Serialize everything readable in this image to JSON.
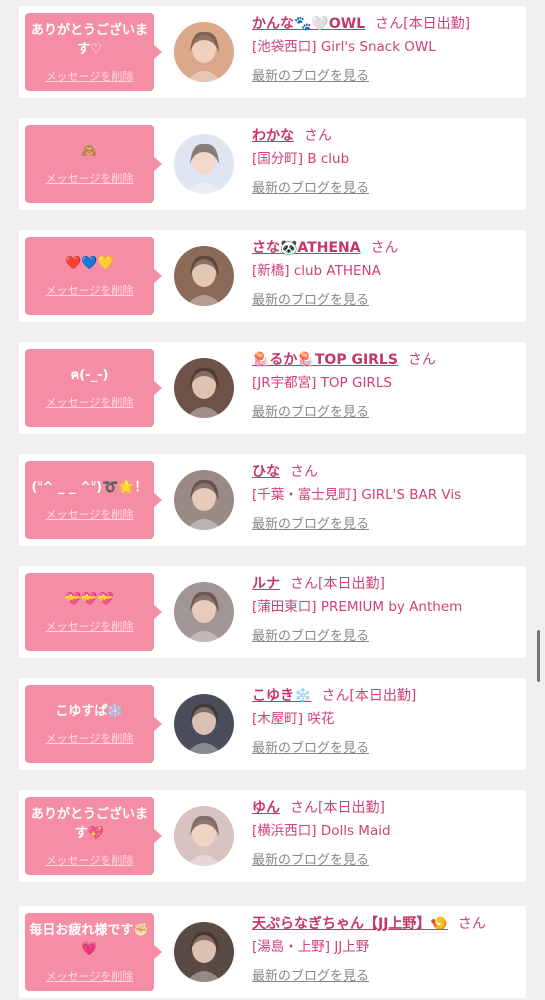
{
  "items": [
    {
      "message": "ありがとうございます♡",
      "delete_label": "メッセージを削除",
      "name": "かんな🐾🤍OWL",
      "suffix": "さん[本日出勤]",
      "shop": "[池袋西口] Girl's Snack OWL",
      "blog_label": "最新のブログを見る",
      "avatar_color": "#d9a98a"
    },
    {
      "message": "🙈",
      "delete_label": "メッセージを削除",
      "name": "わかな",
      "suffix": "さん",
      "shop": "[国分町] B club",
      "blog_label": "最新のブログを見る",
      "avatar_color": "#dfe6f2"
    },
    {
      "message": "❤️💙💛",
      "delete_label": "メッセージを削除",
      "name": "さな🐼ATHENA",
      "suffix": "さん",
      "shop": "[新橋] club ATHENA",
      "blog_label": "最新のブログを見る",
      "avatar_color": "#8a6a58"
    },
    {
      "message": "ฅ(-_-)",
      "delete_label": "メッセージを削除",
      "name": "🪼るか🪼TOP GIRLS",
      "suffix": "さん",
      "shop": "[JR宇都宮] TOP GIRLS",
      "blog_label": "最新のブログを見る",
      "avatar_color": "#6e5248"
    },
    {
      "message": "(ᐡ^ _ _ ^ᐡ)➰🌟！",
      "delete_label": "メッセージを削除",
      "name": "ひな",
      "suffix": "さん",
      "shop": "[千葉・富士見町] GIRL'S BAR Vis",
      "blog_label": "最新のブログを見る",
      "avatar_color": "#9a8a86"
    },
    {
      "message": "💝💝💝",
      "delete_label": "メッセージを削除",
      "name": "ルナ",
      "suffix": "さん[本日出勤]",
      "shop": "[蒲田東口] PREMIUM by Anthem",
      "blog_label": "最新のブログを見る",
      "avatar_color": "#a29694"
    },
    {
      "message": "こゆすぱ❄️",
      "delete_label": "メッセージを削除",
      "name": "こゆき❄️",
      "suffix": "さん[本日出勤]",
      "shop": "[木屋町] 咲花",
      "blog_label": "最新のブログを見る",
      "avatar_color": "#4a4e5a"
    },
    {
      "message": "ありがとうございます💖",
      "delete_label": "メッセージを削除",
      "name": "ゆん",
      "suffix": "さん[本日出勤]",
      "shop": "[横浜西口] Dolls Maid",
      "blog_label": "最新のブログを見る",
      "avatar_color": "#d8c2c2"
    },
    {
      "message": "毎日お疲れ様です✊🏻💗",
      "delete_label": "メッセージを削除",
      "name": "天ぷらなぎちゃん【JJ上野】🍤",
      "suffix": "さん",
      "shop": "[湯島・上野] JJ上野",
      "blog_label": "最新のブログを見る",
      "avatar_color": "#5a4a44"
    }
  ]
}
